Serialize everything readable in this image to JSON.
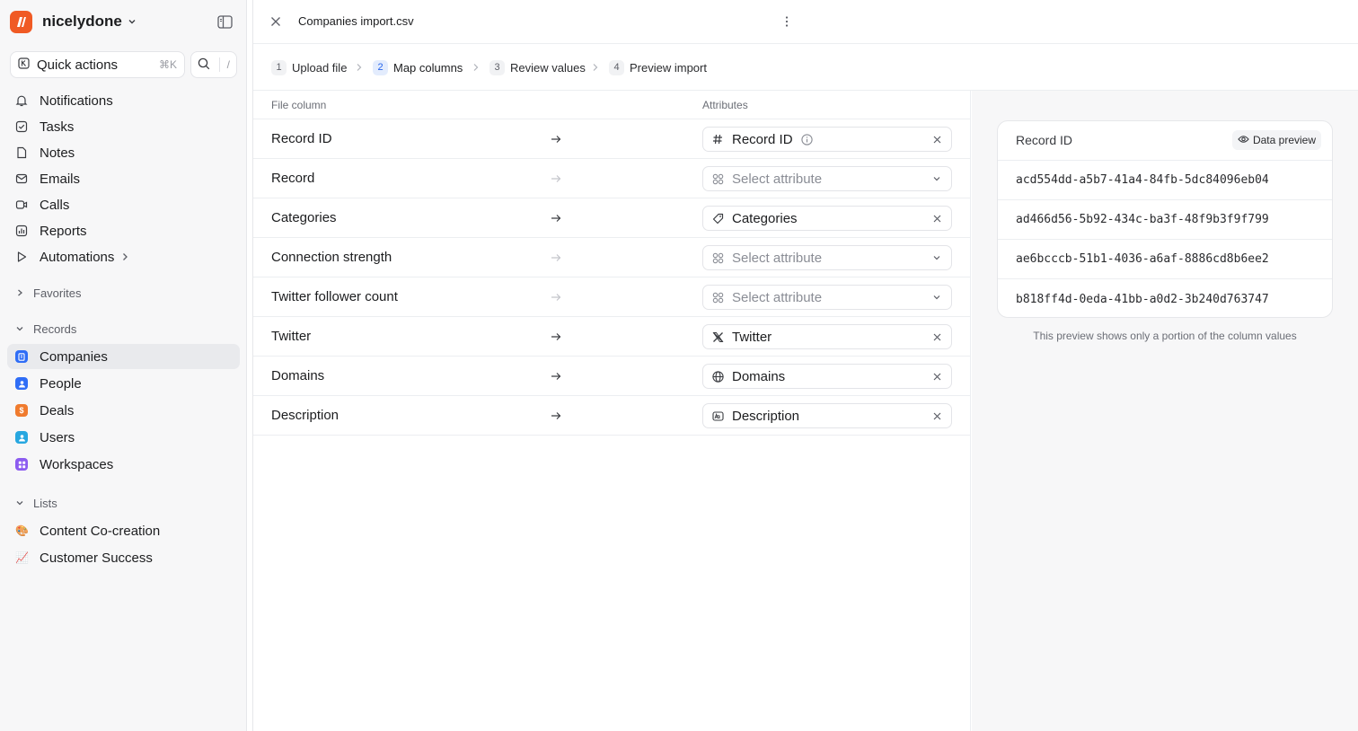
{
  "workspace": {
    "name": "nicelydone",
    "logo_color": "#f05a24"
  },
  "quick_actions": {
    "label": "Quick actions",
    "shortcut": "⌘K",
    "search_shortcut": "/"
  },
  "nav": [
    {
      "label": "Notifications",
      "icon": "bell-icon"
    },
    {
      "label": "Tasks",
      "icon": "checkbox-icon"
    },
    {
      "label": "Notes",
      "icon": "note-icon"
    },
    {
      "label": "Emails",
      "icon": "mail-icon"
    },
    {
      "label": "Calls",
      "icon": "video-icon"
    },
    {
      "label": "Reports",
      "icon": "chart-icon"
    },
    {
      "label": "Automations",
      "icon": "play-icon"
    }
  ],
  "sections": {
    "favorites": "Favorites",
    "records": "Records",
    "lists": "Lists"
  },
  "records": [
    {
      "label": "Companies",
      "icon": "company-icon",
      "color": "#2f6df6"
    },
    {
      "label": "People",
      "icon": "person-icon",
      "color": "#2f6df6"
    },
    {
      "label": "Deals",
      "icon": "deal-icon",
      "color": "#f07b2e"
    },
    {
      "label": "Users",
      "icon": "user-icon",
      "color": "#27a7e0"
    },
    {
      "label": "Workspaces",
      "icon": "workspace-icon",
      "color": "#8c5cf0"
    }
  ],
  "lists": [
    {
      "label": "Content Co-creation",
      "emoji": "🎨"
    },
    {
      "label": "Customer Success",
      "emoji": "📈"
    }
  ],
  "header": {
    "file_title": "Companies import.csv"
  },
  "steps": [
    {
      "num": "1",
      "label": "Upload file"
    },
    {
      "num": "2",
      "label": "Map columns"
    },
    {
      "num": "3",
      "label": "Review values"
    },
    {
      "num": "4",
      "label": "Preview import"
    }
  ],
  "mapping": {
    "file_column_header": "File column",
    "attributes_header": "Attributes",
    "rows": [
      {
        "column": "Record ID",
        "attribute": "Record ID",
        "icon": "hash-icon",
        "mapped": true
      },
      {
        "column": "Record",
        "attribute": "Select attribute",
        "icon": "grid-icon",
        "mapped": false
      },
      {
        "column": "Categories",
        "attribute": "Categories",
        "icon": "tag-icon",
        "mapped": true
      },
      {
        "column": "Connection strength",
        "attribute": "Select attribute",
        "icon": "grid-icon",
        "mapped": false
      },
      {
        "column": "Twitter follower count",
        "attribute": "Select attribute",
        "icon": "grid-icon",
        "mapped": false
      },
      {
        "column": "Twitter",
        "attribute": "Twitter",
        "icon": "x-logo-icon",
        "mapped": true
      },
      {
        "column": "Domains",
        "attribute": "Domains",
        "icon": "globe-icon",
        "mapped": true
      },
      {
        "column": "Description",
        "attribute": "Description",
        "icon": "text-icon",
        "mapped": true
      }
    ]
  },
  "preview": {
    "title": "Record ID",
    "button": "Data preview",
    "values": [
      "acd554dd-a5b7-41a4-84fb-5dc84096eb04",
      "ad466d56-5b92-434c-ba3f-48f9b3f9f799",
      "ae6bcccb-51b1-4036-a6af-8886cd8b6ee2",
      "b818ff4d-0eda-41bb-a0d2-3b240d763747"
    ],
    "note": "This preview shows only a portion of the column values"
  }
}
